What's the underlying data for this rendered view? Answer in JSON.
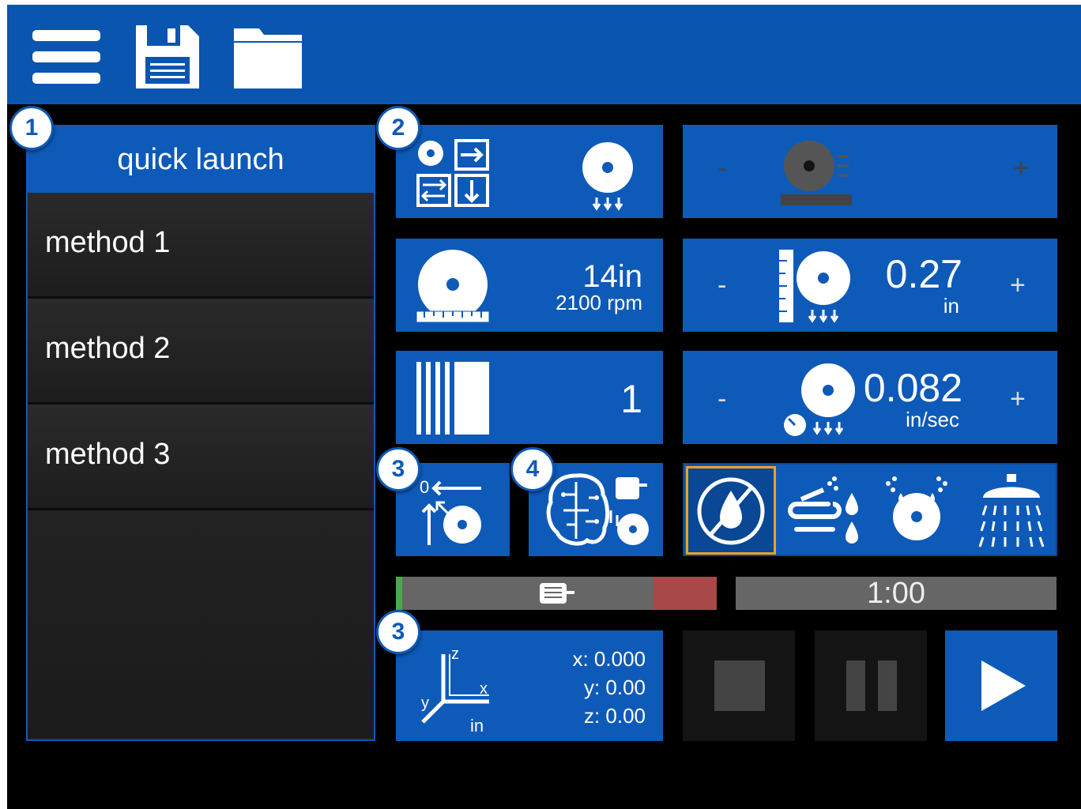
{
  "toolbar": {
    "menu_icon": "hamburger-menu-icon",
    "save_icon": "floppy-disk-icon",
    "open_icon": "folder-icon"
  },
  "quick_launch": {
    "title": "quick launch",
    "items": [
      {
        "label": "method 1"
      },
      {
        "label": "method 2"
      },
      {
        "label": "method 3"
      }
    ]
  },
  "badges": {
    "b1": "1",
    "b2": "2",
    "b3a": "3",
    "b4": "4",
    "b3b": "3"
  },
  "blade_size": {
    "value": "14in",
    "speed": "2100 rpm"
  },
  "depth": {
    "minus": "-",
    "value": "0.27",
    "unit": "in",
    "plus": "+"
  },
  "disabled_control": {
    "minus": "-",
    "plus": "+"
  },
  "cuts": {
    "value": "1"
  },
  "feed": {
    "minus": "-",
    "value": "0.082",
    "unit": "in/sec",
    "plus": "+"
  },
  "coolant": {
    "options": [
      {
        "icon": "no-coolant-icon",
        "selected": true
      },
      {
        "icon": "hose-coolant-icon",
        "selected": false
      },
      {
        "icon": "blade-spray-icon",
        "selected": false
      },
      {
        "icon": "shower-icon",
        "selected": false
      }
    ]
  },
  "motor_load": {
    "icon": "motor-icon",
    "level": 0.02
  },
  "timer": {
    "value": "1:00"
  },
  "position": {
    "x": "x: 0.000",
    "y": "y: 0.00",
    "z": "z: 0.00",
    "unit": "in",
    "axis_labels": {
      "z": "z",
      "x": "x",
      "y": "y"
    }
  },
  "colors": {
    "accent": "#0e5ab8",
    "background": "#000000",
    "selected": "#f0a020"
  }
}
